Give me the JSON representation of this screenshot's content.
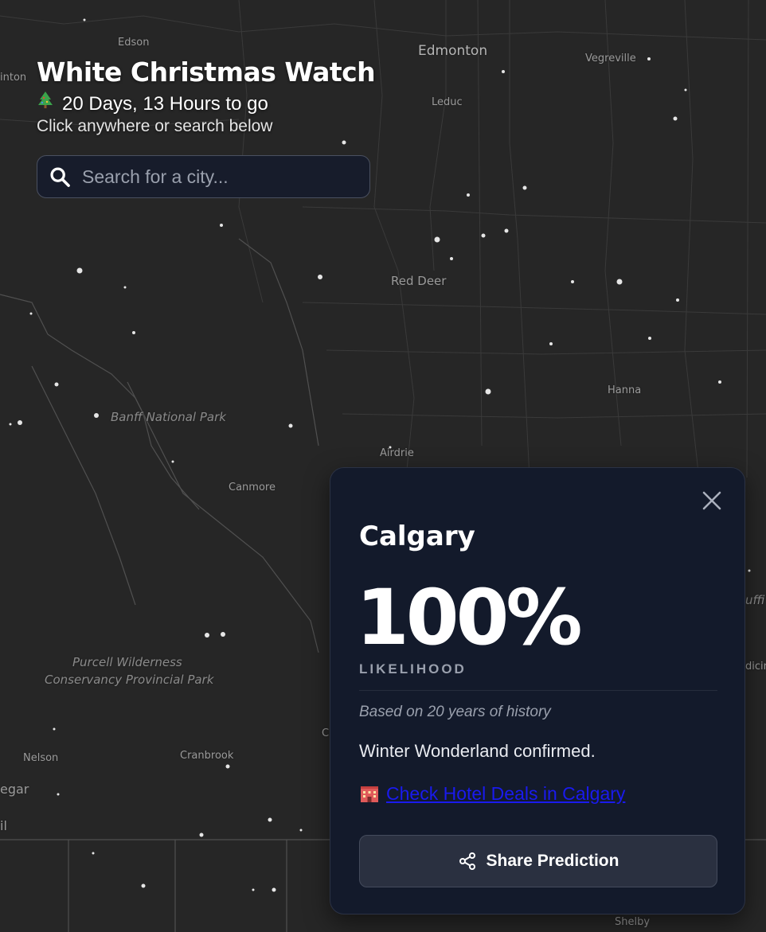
{
  "app": {
    "title": "White Christmas Watch",
    "countdown_icon": "christmas-tree-icon",
    "countdown": "20 Days, 13 Hours to go",
    "subtitle": "Click anywhere or search below"
  },
  "search": {
    "placeholder": "Search for a city...",
    "value": "",
    "icon": "search-icon"
  },
  "map": {
    "labels": {
      "edson": "Edson",
      "edmonton": "Edmonton",
      "vegreville": "Vegreville",
      "inton": "inton",
      "leduc": "Leduc",
      "red_deer": "Red Deer",
      "hanna": "Hanna",
      "banff": "Banff National Park",
      "airdrie": "Airdrie",
      "canmore": "Canmore",
      "purcell_1": "Purcell Wilderness",
      "purcell_2": "Conservancy Provincial Park",
      "nelson": "Nelson",
      "cranbrook": "Cranbrook",
      "egar": "egar",
      "il": "il",
      "shelby": "Shelby",
      "uffi": "uffi",
      "dicin": "dicin",
      "c_edge": "C"
    }
  },
  "card": {
    "city": "Calgary",
    "percent": "100%",
    "likelihood_label": "LIKELIHOOD",
    "basis": "Based on 20 years of history",
    "verdict": "Winter Wonderland confirmed.",
    "hotel_link": "Check Hotel Deals in Calgary",
    "hotel_icon": "hotel-icon",
    "share_label": "Share Prediction",
    "share_icon": "share-icon",
    "close_icon": "close-icon"
  },
  "colors": {
    "map_background": "#262626",
    "panel_background": "#131a2b",
    "link": "#1a1aee"
  }
}
